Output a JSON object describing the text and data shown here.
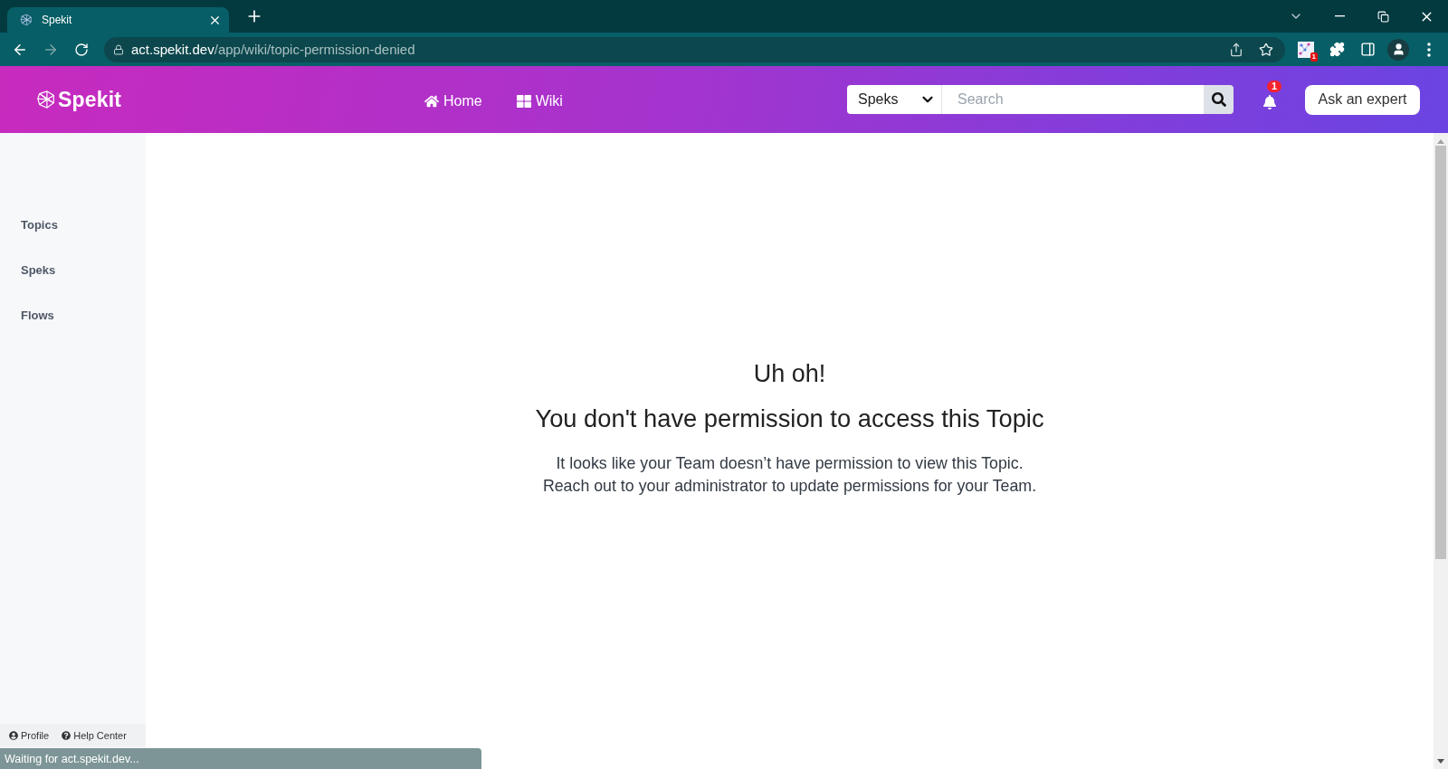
{
  "browser": {
    "tab": {
      "title": "Spekit"
    },
    "url": {
      "host": "act.spekit.dev",
      "path": "/app/wiki/topic-permission-denied"
    },
    "extension_badge": "1"
  },
  "header": {
    "logo": "Spekit",
    "nav": [
      {
        "label": "Home",
        "kind": "home"
      },
      {
        "label": "Wiki",
        "kind": "wiki"
      }
    ],
    "search": {
      "scope": "Speks",
      "placeholder": "Search"
    },
    "notification_count": "1",
    "ask_button": "Ask an expert"
  },
  "sidebar": {
    "items": [
      {
        "label": "Topics"
      },
      {
        "label": "Speks"
      },
      {
        "label": "Flows"
      }
    ],
    "footer": [
      {
        "label": "Profile",
        "kind": "profile"
      },
      {
        "label": "Help Center",
        "kind": "help"
      }
    ]
  },
  "message": {
    "title": "Uh oh!",
    "heading": "You don't have permission to access this Topic",
    "lines": [
      "It looks like your Team doesn’t have permission to view this Topic.",
      "Reach out to your administrator to update permissions for your Team."
    ]
  },
  "status_bar": "Waiting for act.spekit.dev..."
}
